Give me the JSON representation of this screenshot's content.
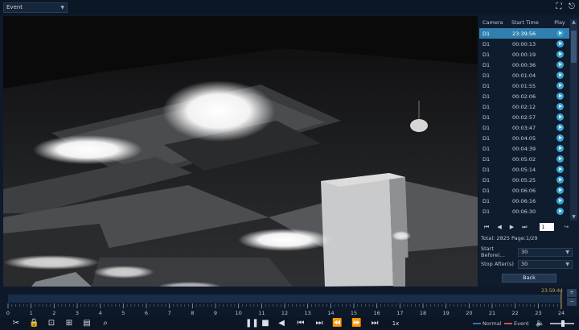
{
  "mode_select": {
    "value": "Event"
  },
  "top_icons": {
    "fullscreen": "fullscreen-icon",
    "exit": "exit-icon"
  },
  "event_table": {
    "headers": [
      "Camera",
      "Start Time",
      "Play"
    ],
    "rows": [
      {
        "camera": "D1",
        "start": "23:39:56",
        "selected": true
      },
      {
        "camera": "D1",
        "start": "00:00:13"
      },
      {
        "camera": "D1",
        "start": "00:00:19"
      },
      {
        "camera": "D1",
        "start": "00:00:36"
      },
      {
        "camera": "D1",
        "start": "00:01:04"
      },
      {
        "camera": "D1",
        "start": "00:01:55"
      },
      {
        "camera": "D1",
        "start": "00:02:06"
      },
      {
        "camera": "D1",
        "start": "00:02:12"
      },
      {
        "camera": "D1",
        "start": "00:02:57"
      },
      {
        "camera": "D1",
        "start": "00:03:47"
      },
      {
        "camera": "D1",
        "start": "00:04:05"
      },
      {
        "camera": "D1",
        "start": "00:04:39"
      },
      {
        "camera": "D1",
        "start": "00:05:02"
      },
      {
        "camera": "D1",
        "start": "00:05:14"
      },
      {
        "camera": "D1",
        "start": "00:05:25"
      },
      {
        "camera": "D1",
        "start": "00:06:06"
      },
      {
        "camera": "D1",
        "start": "00:06:16"
      },
      {
        "camera": "D1",
        "start": "00:06:30"
      }
    ]
  },
  "pager": {
    "page_input": "1"
  },
  "totals": {
    "text": "Total: 2825  Page:1/29"
  },
  "start_before": {
    "label": "Start Before(...",
    "value": "30"
  },
  "stop_after": {
    "label": "Stop After(s)",
    "value": "30"
  },
  "back_button": {
    "label": "Back"
  },
  "timeline": {
    "current_time": "23:59:44",
    "ticks": [
      "0",
      "1",
      "2",
      "3",
      "4",
      "5",
      "6",
      "7",
      "8",
      "9",
      "10",
      "11",
      "12",
      "13",
      "14",
      "15",
      "16",
      "17",
      "18",
      "19",
      "20",
      "21",
      "22",
      "23",
      "24"
    ],
    "zoom_in": "+",
    "zoom_out": "−"
  },
  "playback": {
    "speed": "1x"
  },
  "legend": {
    "normal": "Normal",
    "event": "Event",
    "normal_color": "#3d6ea8",
    "event_color": "#d6504a"
  },
  "colors": {
    "accent": "#2f7fb0",
    "timestamp": "#bfa55a"
  }
}
